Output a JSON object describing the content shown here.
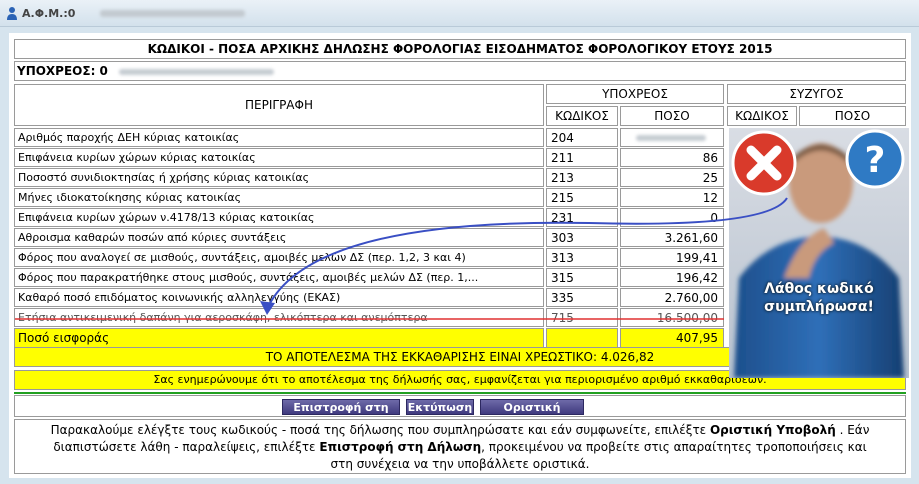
{
  "header": {
    "afm_label": "Α.Φ.Μ.:0"
  },
  "form": {
    "title": "ΚΩΔΙΚΟΙ - ΠΟΣΑ ΑΡΧΙΚΗΣ ΔΗΛΩΣΗΣ ΦΟΡΟΛΟΓΙΑΣ ΕΙΣΟΔΗΜΑΤΟΣ ΦΟΡΟΛΟΓΙΚΟΥ ΕΤΟΥΣ 2015",
    "taxpayer_label": "ΥΠΟΧΡΕΟΣ: 0",
    "col_description": "ΠΕΡΙΓΡΑΦΗ",
    "col_taxpayer": "ΥΠΟΧΡΕΟΣ",
    "col_spouse": "ΣΥΖΥΓΟΣ",
    "col_code": "ΚΩΔΙΚΟΣ",
    "col_amount": "ΠΟΣΟ",
    "rows": [
      {
        "desc": "Αριθμός παροχής ΔΕΗ κύριας κατοικίας",
        "code": "204",
        "amount": ""
      },
      {
        "desc": "Επιφάνεια κυρίων χώρων κύριας κατοικίας",
        "code": "211",
        "amount": "86"
      },
      {
        "desc": "Ποσοστό συνιδιοκτησίας ή χρήσης κύριας κατοικίας",
        "code": "213",
        "amount": "25"
      },
      {
        "desc": "Μήνες ιδιοκατοίκησης κύριας κατοικίας",
        "code": "215",
        "amount": "12"
      },
      {
        "desc": "Επιφάνεια κυρίων χώρων ν.4178/13 κύριας κατοικίας",
        "code": "231",
        "amount": "0"
      },
      {
        "desc": "Αθροισμα καθαρών ποσών από κύριες συντάξεις",
        "code": "303",
        "amount": "3.261,60"
      },
      {
        "desc": "Φόρος που αναλογεί σε μισθούς, συντάξεις, αμοιβές μελών ΔΣ (περ. 1,2, 3 και 4)",
        "code": "313",
        "amount": "199,41"
      },
      {
        "desc": "Φόρος που παρακρατήθηκε στους μισθούς, συντάξεις, αμοιβές μελών ΔΣ (περ. 1,...",
        "code": "315",
        "amount": "196,42"
      },
      {
        "desc": "Καθαρό ποσό επιδόματος κοινωνικής αλληλεγγύης (ΕΚΑΣ)",
        "code": "335",
        "amount": "2.760,00"
      },
      {
        "desc": "Ετήσια αντικειμενική δαπάνη για αεροσκάφη, ελικόπτερα και ανεμόπτερα",
        "code": "715",
        "amount": "16.500,00"
      }
    ],
    "contribution_label": "Ποσό εισφοράς",
    "contribution_amount": "407,95",
    "result_text": "ΤΟ ΑΠΟΤΕΛΕΣΜΑ ΤΗΣ ΕΚΚΑΘΑΡΙΣΗΣ ΕΙΝΑΙ ΧΡΕΩΣΤΙΚΟ: 4.026,82",
    "info_text": "Σας ενημερώνουμε ότι το αποτέλεσμα της δήλωσής σας, εμφανίζεται για περιορισμένο αριθμό εκκαθαρίσεων."
  },
  "buttons": {
    "back": "Επιστροφή στη Δήλωση",
    "print": "Εκτύπωση",
    "submit": "Οριστική Υποβολή"
  },
  "note": {
    "p1": "Παρακαλούμε ελέγξτε τους κωδικούς - ποσά της δήλωσης που συμπληρώσατε και εάν συμφωνείτε, επιλέξτε ",
    "b1": "Οριστική Υποβολή",
    "p2": " . Εάν",
    "p3": "διαπιστώσετε λάθη - παραλείψεις, επιλέξτε ",
    "b2": "Επιστροφή στη Δήλωση",
    "p4": ", προκειμένου να προβείτε στις απαραίτητες τροποποιήσεις και",
    "p5": "στη συνέχεια να την υποβάλλετε οριστικά."
  },
  "overlay": {
    "caption_line1": "Λάθος κωδικό",
    "caption_line2": "συμπλήρωσα!"
  },
  "colors": {
    "highlight": "#ffff00",
    "arrow": "#3a4fc4",
    "strike": "#e03030",
    "button": "#4a4590",
    "x_badge": "#d93a2b",
    "q_badge": "#2f7ac4"
  }
}
